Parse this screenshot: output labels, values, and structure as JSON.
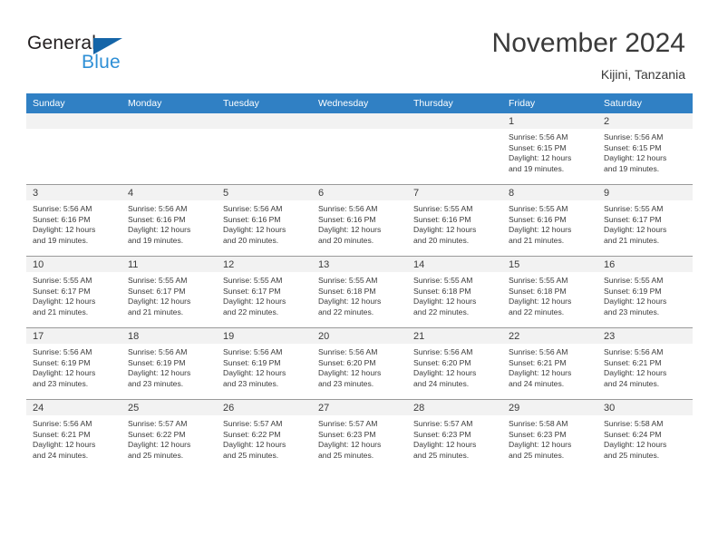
{
  "brand": {
    "name_part1": "General",
    "name_part2": "Blue",
    "flag_icon": "triangle-flag-icon",
    "accent_color": "#1565a8",
    "secondary_color": "#2e8fd6"
  },
  "header": {
    "title": "November 2024",
    "subtitle": "Kijini, Tanzania"
  },
  "calendar": {
    "header_background": "#3080c4",
    "daynum_background": "#f2f2f2",
    "weekday_headers": [
      "Sunday",
      "Monday",
      "Tuesday",
      "Wednesday",
      "Thursday",
      "Friday",
      "Saturday"
    ],
    "weeks": [
      [
        {
          "day": "",
          "empty": true
        },
        {
          "day": "",
          "empty": true
        },
        {
          "day": "",
          "empty": true
        },
        {
          "day": "",
          "empty": true
        },
        {
          "day": "",
          "empty": true
        },
        {
          "day": "1",
          "sunrise": "Sunrise: 5:56 AM",
          "sunset": "Sunset: 6:15 PM",
          "daylight_line1": "Daylight: 12 hours",
          "daylight_line2": "and 19 minutes."
        },
        {
          "day": "2",
          "sunrise": "Sunrise: 5:56 AM",
          "sunset": "Sunset: 6:15 PM",
          "daylight_line1": "Daylight: 12 hours",
          "daylight_line2": "and 19 minutes."
        }
      ],
      [
        {
          "day": "3",
          "sunrise": "Sunrise: 5:56 AM",
          "sunset": "Sunset: 6:16 PM",
          "daylight_line1": "Daylight: 12 hours",
          "daylight_line2": "and 19 minutes."
        },
        {
          "day": "4",
          "sunrise": "Sunrise: 5:56 AM",
          "sunset": "Sunset: 6:16 PM",
          "daylight_line1": "Daylight: 12 hours",
          "daylight_line2": "and 19 minutes."
        },
        {
          "day": "5",
          "sunrise": "Sunrise: 5:56 AM",
          "sunset": "Sunset: 6:16 PM",
          "daylight_line1": "Daylight: 12 hours",
          "daylight_line2": "and 20 minutes."
        },
        {
          "day": "6",
          "sunrise": "Sunrise: 5:56 AM",
          "sunset": "Sunset: 6:16 PM",
          "daylight_line1": "Daylight: 12 hours",
          "daylight_line2": "and 20 minutes."
        },
        {
          "day": "7",
          "sunrise": "Sunrise: 5:55 AM",
          "sunset": "Sunset: 6:16 PM",
          "daylight_line1": "Daylight: 12 hours",
          "daylight_line2": "and 20 minutes."
        },
        {
          "day": "8",
          "sunrise": "Sunrise: 5:55 AM",
          "sunset": "Sunset: 6:16 PM",
          "daylight_line1": "Daylight: 12 hours",
          "daylight_line2": "and 21 minutes."
        },
        {
          "day": "9",
          "sunrise": "Sunrise: 5:55 AM",
          "sunset": "Sunset: 6:17 PM",
          "daylight_line1": "Daylight: 12 hours",
          "daylight_line2": "and 21 minutes."
        }
      ],
      [
        {
          "day": "10",
          "sunrise": "Sunrise: 5:55 AM",
          "sunset": "Sunset: 6:17 PM",
          "daylight_line1": "Daylight: 12 hours",
          "daylight_line2": "and 21 minutes."
        },
        {
          "day": "11",
          "sunrise": "Sunrise: 5:55 AM",
          "sunset": "Sunset: 6:17 PM",
          "daylight_line1": "Daylight: 12 hours",
          "daylight_line2": "and 21 minutes."
        },
        {
          "day": "12",
          "sunrise": "Sunrise: 5:55 AM",
          "sunset": "Sunset: 6:17 PM",
          "daylight_line1": "Daylight: 12 hours",
          "daylight_line2": "and 22 minutes."
        },
        {
          "day": "13",
          "sunrise": "Sunrise: 5:55 AM",
          "sunset": "Sunset: 6:18 PM",
          "daylight_line1": "Daylight: 12 hours",
          "daylight_line2": "and 22 minutes."
        },
        {
          "day": "14",
          "sunrise": "Sunrise: 5:55 AM",
          "sunset": "Sunset: 6:18 PM",
          "daylight_line1": "Daylight: 12 hours",
          "daylight_line2": "and 22 minutes."
        },
        {
          "day": "15",
          "sunrise": "Sunrise: 5:55 AM",
          "sunset": "Sunset: 6:18 PM",
          "daylight_line1": "Daylight: 12 hours",
          "daylight_line2": "and 22 minutes."
        },
        {
          "day": "16",
          "sunrise": "Sunrise: 5:55 AM",
          "sunset": "Sunset: 6:19 PM",
          "daylight_line1": "Daylight: 12 hours",
          "daylight_line2": "and 23 minutes."
        }
      ],
      [
        {
          "day": "17",
          "sunrise": "Sunrise: 5:56 AM",
          "sunset": "Sunset: 6:19 PM",
          "daylight_line1": "Daylight: 12 hours",
          "daylight_line2": "and 23 minutes."
        },
        {
          "day": "18",
          "sunrise": "Sunrise: 5:56 AM",
          "sunset": "Sunset: 6:19 PM",
          "daylight_line1": "Daylight: 12 hours",
          "daylight_line2": "and 23 minutes."
        },
        {
          "day": "19",
          "sunrise": "Sunrise: 5:56 AM",
          "sunset": "Sunset: 6:19 PM",
          "daylight_line1": "Daylight: 12 hours",
          "daylight_line2": "and 23 minutes."
        },
        {
          "day": "20",
          "sunrise": "Sunrise: 5:56 AM",
          "sunset": "Sunset: 6:20 PM",
          "daylight_line1": "Daylight: 12 hours",
          "daylight_line2": "and 23 minutes."
        },
        {
          "day": "21",
          "sunrise": "Sunrise: 5:56 AM",
          "sunset": "Sunset: 6:20 PM",
          "daylight_line1": "Daylight: 12 hours",
          "daylight_line2": "and 24 minutes."
        },
        {
          "day": "22",
          "sunrise": "Sunrise: 5:56 AM",
          "sunset": "Sunset: 6:21 PM",
          "daylight_line1": "Daylight: 12 hours",
          "daylight_line2": "and 24 minutes."
        },
        {
          "day": "23",
          "sunrise": "Sunrise: 5:56 AM",
          "sunset": "Sunset: 6:21 PM",
          "daylight_line1": "Daylight: 12 hours",
          "daylight_line2": "and 24 minutes."
        }
      ],
      [
        {
          "day": "24",
          "sunrise": "Sunrise: 5:56 AM",
          "sunset": "Sunset: 6:21 PM",
          "daylight_line1": "Daylight: 12 hours",
          "daylight_line2": "and 24 minutes."
        },
        {
          "day": "25",
          "sunrise": "Sunrise: 5:57 AM",
          "sunset": "Sunset: 6:22 PM",
          "daylight_line1": "Daylight: 12 hours",
          "daylight_line2": "and 25 minutes."
        },
        {
          "day": "26",
          "sunrise": "Sunrise: 5:57 AM",
          "sunset": "Sunset: 6:22 PM",
          "daylight_line1": "Daylight: 12 hours",
          "daylight_line2": "and 25 minutes."
        },
        {
          "day": "27",
          "sunrise": "Sunrise: 5:57 AM",
          "sunset": "Sunset: 6:23 PM",
          "daylight_line1": "Daylight: 12 hours",
          "daylight_line2": "and 25 minutes."
        },
        {
          "day": "28",
          "sunrise": "Sunrise: 5:57 AM",
          "sunset": "Sunset: 6:23 PM",
          "daylight_line1": "Daylight: 12 hours",
          "daylight_line2": "and 25 minutes."
        },
        {
          "day": "29",
          "sunrise": "Sunrise: 5:58 AM",
          "sunset": "Sunset: 6:23 PM",
          "daylight_line1": "Daylight: 12 hours",
          "daylight_line2": "and 25 minutes."
        },
        {
          "day": "30",
          "sunrise": "Sunrise: 5:58 AM",
          "sunset": "Sunset: 6:24 PM",
          "daylight_line1": "Daylight: 12 hours",
          "daylight_line2": "and 25 minutes."
        }
      ]
    ]
  }
}
